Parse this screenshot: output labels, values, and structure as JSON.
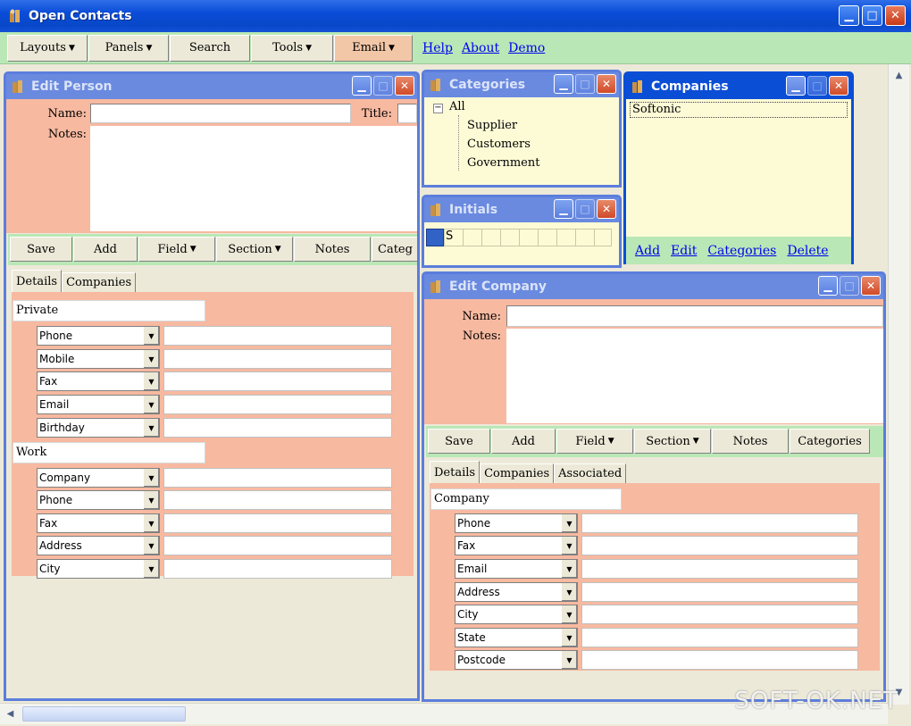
{
  "window": {
    "title": "Open Contacts"
  },
  "menubar": {
    "buttons": [
      {
        "label": "Layouts",
        "dropdown": true
      },
      {
        "label": "Panels",
        "dropdown": true
      },
      {
        "label": "Search",
        "dropdown": false
      },
      {
        "label": "Tools",
        "dropdown": true
      },
      {
        "label": "Email",
        "dropdown": true
      }
    ],
    "links": [
      "Help",
      "About",
      "Demo"
    ]
  },
  "edit_person": {
    "title": "Edit Person",
    "name_label": "Name:",
    "title_label": "Title:",
    "notes_label": "Notes:",
    "buttons": [
      "Save",
      "Add",
      "Field",
      "Section",
      "Notes",
      "Categ"
    ],
    "tabs": [
      "Details",
      "Companies"
    ],
    "private_section": "Private",
    "private_fields": [
      "Phone",
      "Mobile",
      "Fax",
      "Email",
      "Birthday"
    ],
    "work_section": "Work",
    "work_fields": [
      "Company",
      "Phone",
      "Fax",
      "Address",
      "City"
    ]
  },
  "categories": {
    "title": "Categories",
    "root": "All",
    "items": [
      "Supplier",
      "Customers",
      "Government"
    ]
  },
  "companies": {
    "title": "Companies",
    "items": [
      "Softonic"
    ],
    "links": [
      "Add",
      "Edit",
      "Categories",
      "Delete"
    ]
  },
  "initials": {
    "title": "Initials",
    "letters": [
      "S"
    ]
  },
  "edit_company": {
    "title": "Edit Company",
    "name_label": "Name:",
    "notes_label": "Notes:",
    "buttons": [
      "Save",
      "Add",
      "Field",
      "Section",
      "Notes",
      "Categories"
    ],
    "tabs": [
      "Details",
      "Companies",
      "Associated"
    ],
    "section": "Company",
    "fields": [
      "Phone",
      "Fax",
      "Email",
      "Address",
      "City",
      "State",
      "Postcode"
    ]
  },
  "watermark": "SOFT-OK.NET",
  "colors": {
    "titlebar": "#0a4cd8",
    "menubar": "#b9e8b6",
    "salmon": "#f7b9a0",
    "cream": "#fdfbd6"
  }
}
